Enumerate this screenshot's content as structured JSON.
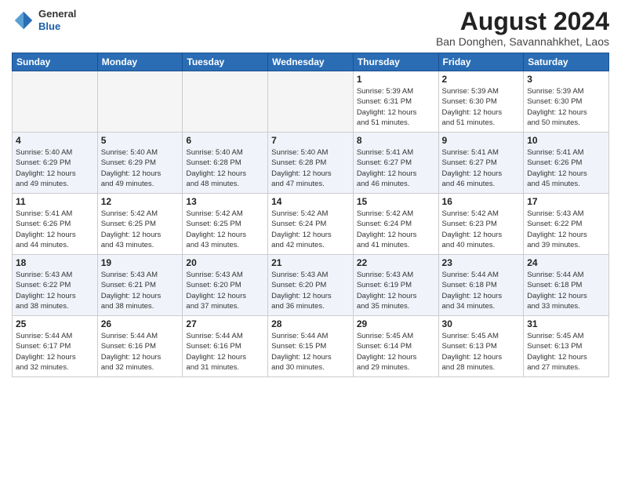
{
  "header": {
    "logo_line1": "General",
    "logo_line2": "Blue",
    "month_year": "August 2024",
    "location": "Ban Donghen, Savannahkhet, Laos"
  },
  "weekdays": [
    "Sunday",
    "Monday",
    "Tuesday",
    "Wednesday",
    "Thursday",
    "Friday",
    "Saturday"
  ],
  "weeks": [
    [
      {
        "day": "",
        "info": ""
      },
      {
        "day": "",
        "info": ""
      },
      {
        "day": "",
        "info": ""
      },
      {
        "day": "",
        "info": ""
      },
      {
        "day": "1",
        "info": "Sunrise: 5:39 AM\nSunset: 6:31 PM\nDaylight: 12 hours\nand 51 minutes."
      },
      {
        "day": "2",
        "info": "Sunrise: 5:39 AM\nSunset: 6:30 PM\nDaylight: 12 hours\nand 51 minutes."
      },
      {
        "day": "3",
        "info": "Sunrise: 5:39 AM\nSunset: 6:30 PM\nDaylight: 12 hours\nand 50 minutes."
      }
    ],
    [
      {
        "day": "4",
        "info": "Sunrise: 5:40 AM\nSunset: 6:29 PM\nDaylight: 12 hours\nand 49 minutes."
      },
      {
        "day": "5",
        "info": "Sunrise: 5:40 AM\nSunset: 6:29 PM\nDaylight: 12 hours\nand 49 minutes."
      },
      {
        "day": "6",
        "info": "Sunrise: 5:40 AM\nSunset: 6:28 PM\nDaylight: 12 hours\nand 48 minutes."
      },
      {
        "day": "7",
        "info": "Sunrise: 5:40 AM\nSunset: 6:28 PM\nDaylight: 12 hours\nand 47 minutes."
      },
      {
        "day": "8",
        "info": "Sunrise: 5:41 AM\nSunset: 6:27 PM\nDaylight: 12 hours\nand 46 minutes."
      },
      {
        "day": "9",
        "info": "Sunrise: 5:41 AM\nSunset: 6:27 PM\nDaylight: 12 hours\nand 46 minutes."
      },
      {
        "day": "10",
        "info": "Sunrise: 5:41 AM\nSunset: 6:26 PM\nDaylight: 12 hours\nand 45 minutes."
      }
    ],
    [
      {
        "day": "11",
        "info": "Sunrise: 5:41 AM\nSunset: 6:26 PM\nDaylight: 12 hours\nand 44 minutes."
      },
      {
        "day": "12",
        "info": "Sunrise: 5:42 AM\nSunset: 6:25 PM\nDaylight: 12 hours\nand 43 minutes."
      },
      {
        "day": "13",
        "info": "Sunrise: 5:42 AM\nSunset: 6:25 PM\nDaylight: 12 hours\nand 43 minutes."
      },
      {
        "day": "14",
        "info": "Sunrise: 5:42 AM\nSunset: 6:24 PM\nDaylight: 12 hours\nand 42 minutes."
      },
      {
        "day": "15",
        "info": "Sunrise: 5:42 AM\nSunset: 6:24 PM\nDaylight: 12 hours\nand 41 minutes."
      },
      {
        "day": "16",
        "info": "Sunrise: 5:42 AM\nSunset: 6:23 PM\nDaylight: 12 hours\nand 40 minutes."
      },
      {
        "day": "17",
        "info": "Sunrise: 5:43 AM\nSunset: 6:22 PM\nDaylight: 12 hours\nand 39 minutes."
      }
    ],
    [
      {
        "day": "18",
        "info": "Sunrise: 5:43 AM\nSunset: 6:22 PM\nDaylight: 12 hours\nand 38 minutes."
      },
      {
        "day": "19",
        "info": "Sunrise: 5:43 AM\nSunset: 6:21 PM\nDaylight: 12 hours\nand 38 minutes."
      },
      {
        "day": "20",
        "info": "Sunrise: 5:43 AM\nSunset: 6:20 PM\nDaylight: 12 hours\nand 37 minutes."
      },
      {
        "day": "21",
        "info": "Sunrise: 5:43 AM\nSunset: 6:20 PM\nDaylight: 12 hours\nand 36 minutes."
      },
      {
        "day": "22",
        "info": "Sunrise: 5:43 AM\nSunset: 6:19 PM\nDaylight: 12 hours\nand 35 minutes."
      },
      {
        "day": "23",
        "info": "Sunrise: 5:44 AM\nSunset: 6:18 PM\nDaylight: 12 hours\nand 34 minutes."
      },
      {
        "day": "24",
        "info": "Sunrise: 5:44 AM\nSunset: 6:18 PM\nDaylight: 12 hours\nand 33 minutes."
      }
    ],
    [
      {
        "day": "25",
        "info": "Sunrise: 5:44 AM\nSunset: 6:17 PM\nDaylight: 12 hours\nand 32 minutes."
      },
      {
        "day": "26",
        "info": "Sunrise: 5:44 AM\nSunset: 6:16 PM\nDaylight: 12 hours\nand 32 minutes."
      },
      {
        "day": "27",
        "info": "Sunrise: 5:44 AM\nSunset: 6:16 PM\nDaylight: 12 hours\nand 31 minutes."
      },
      {
        "day": "28",
        "info": "Sunrise: 5:44 AM\nSunset: 6:15 PM\nDaylight: 12 hours\nand 30 minutes."
      },
      {
        "day": "29",
        "info": "Sunrise: 5:45 AM\nSunset: 6:14 PM\nDaylight: 12 hours\nand 29 minutes."
      },
      {
        "day": "30",
        "info": "Sunrise: 5:45 AM\nSunset: 6:13 PM\nDaylight: 12 hours\nand 28 minutes."
      },
      {
        "day": "31",
        "info": "Sunrise: 5:45 AM\nSunset: 6:13 PM\nDaylight: 12 hours\nand 27 minutes."
      }
    ]
  ]
}
